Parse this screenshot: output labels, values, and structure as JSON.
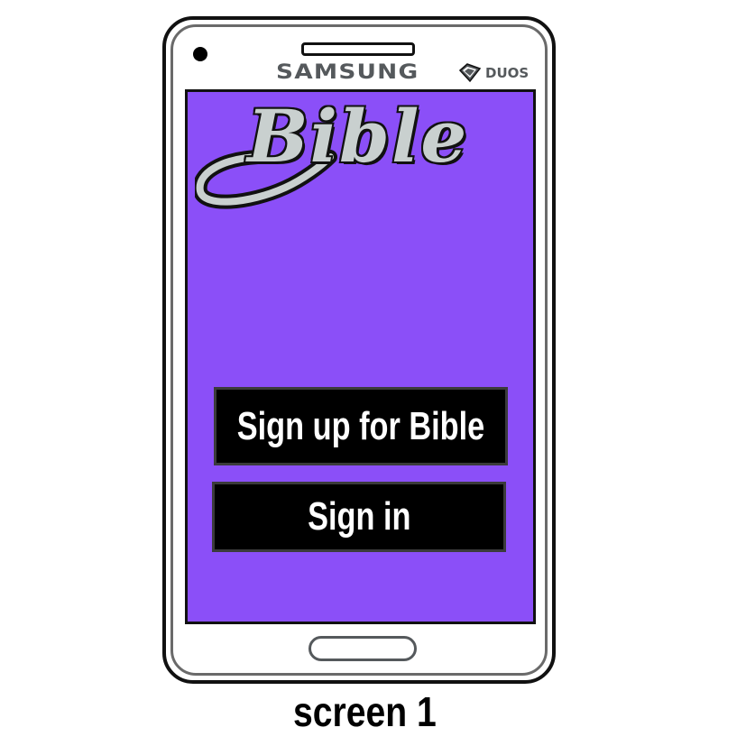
{
  "device": {
    "brand": "SAMSUNG",
    "badge": "DUOS"
  },
  "screen": {
    "logo": "Bible",
    "background_color": "#8b4ff8",
    "buttons": {
      "signup_label": "Sign up for Bible",
      "signin_label": "Sign in"
    }
  },
  "caption": "screen 1",
  "icons": {
    "duos": "duos-diamond-icon",
    "camera": "front-camera-icon",
    "home": "home-button-icon"
  }
}
